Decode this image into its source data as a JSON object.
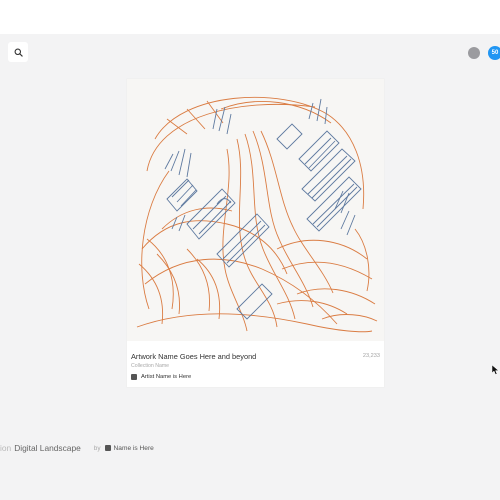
{
  "header": {
    "search_icon": "search-icon",
    "notification_count": "50"
  },
  "card": {
    "title": "Artwork Name Goes Here and beyond",
    "count": "23,233",
    "collection": "Collection Name",
    "artist": "Artist Name is Here",
    "colors": {
      "orange": "#d9763a",
      "blue": "#5f7aa0",
      "background": "#f7f6f4"
    }
  },
  "footer": {
    "prefix": "ion",
    "section_title": "Digital Landscape",
    "by_label": "by",
    "artist": "Name is Here"
  }
}
